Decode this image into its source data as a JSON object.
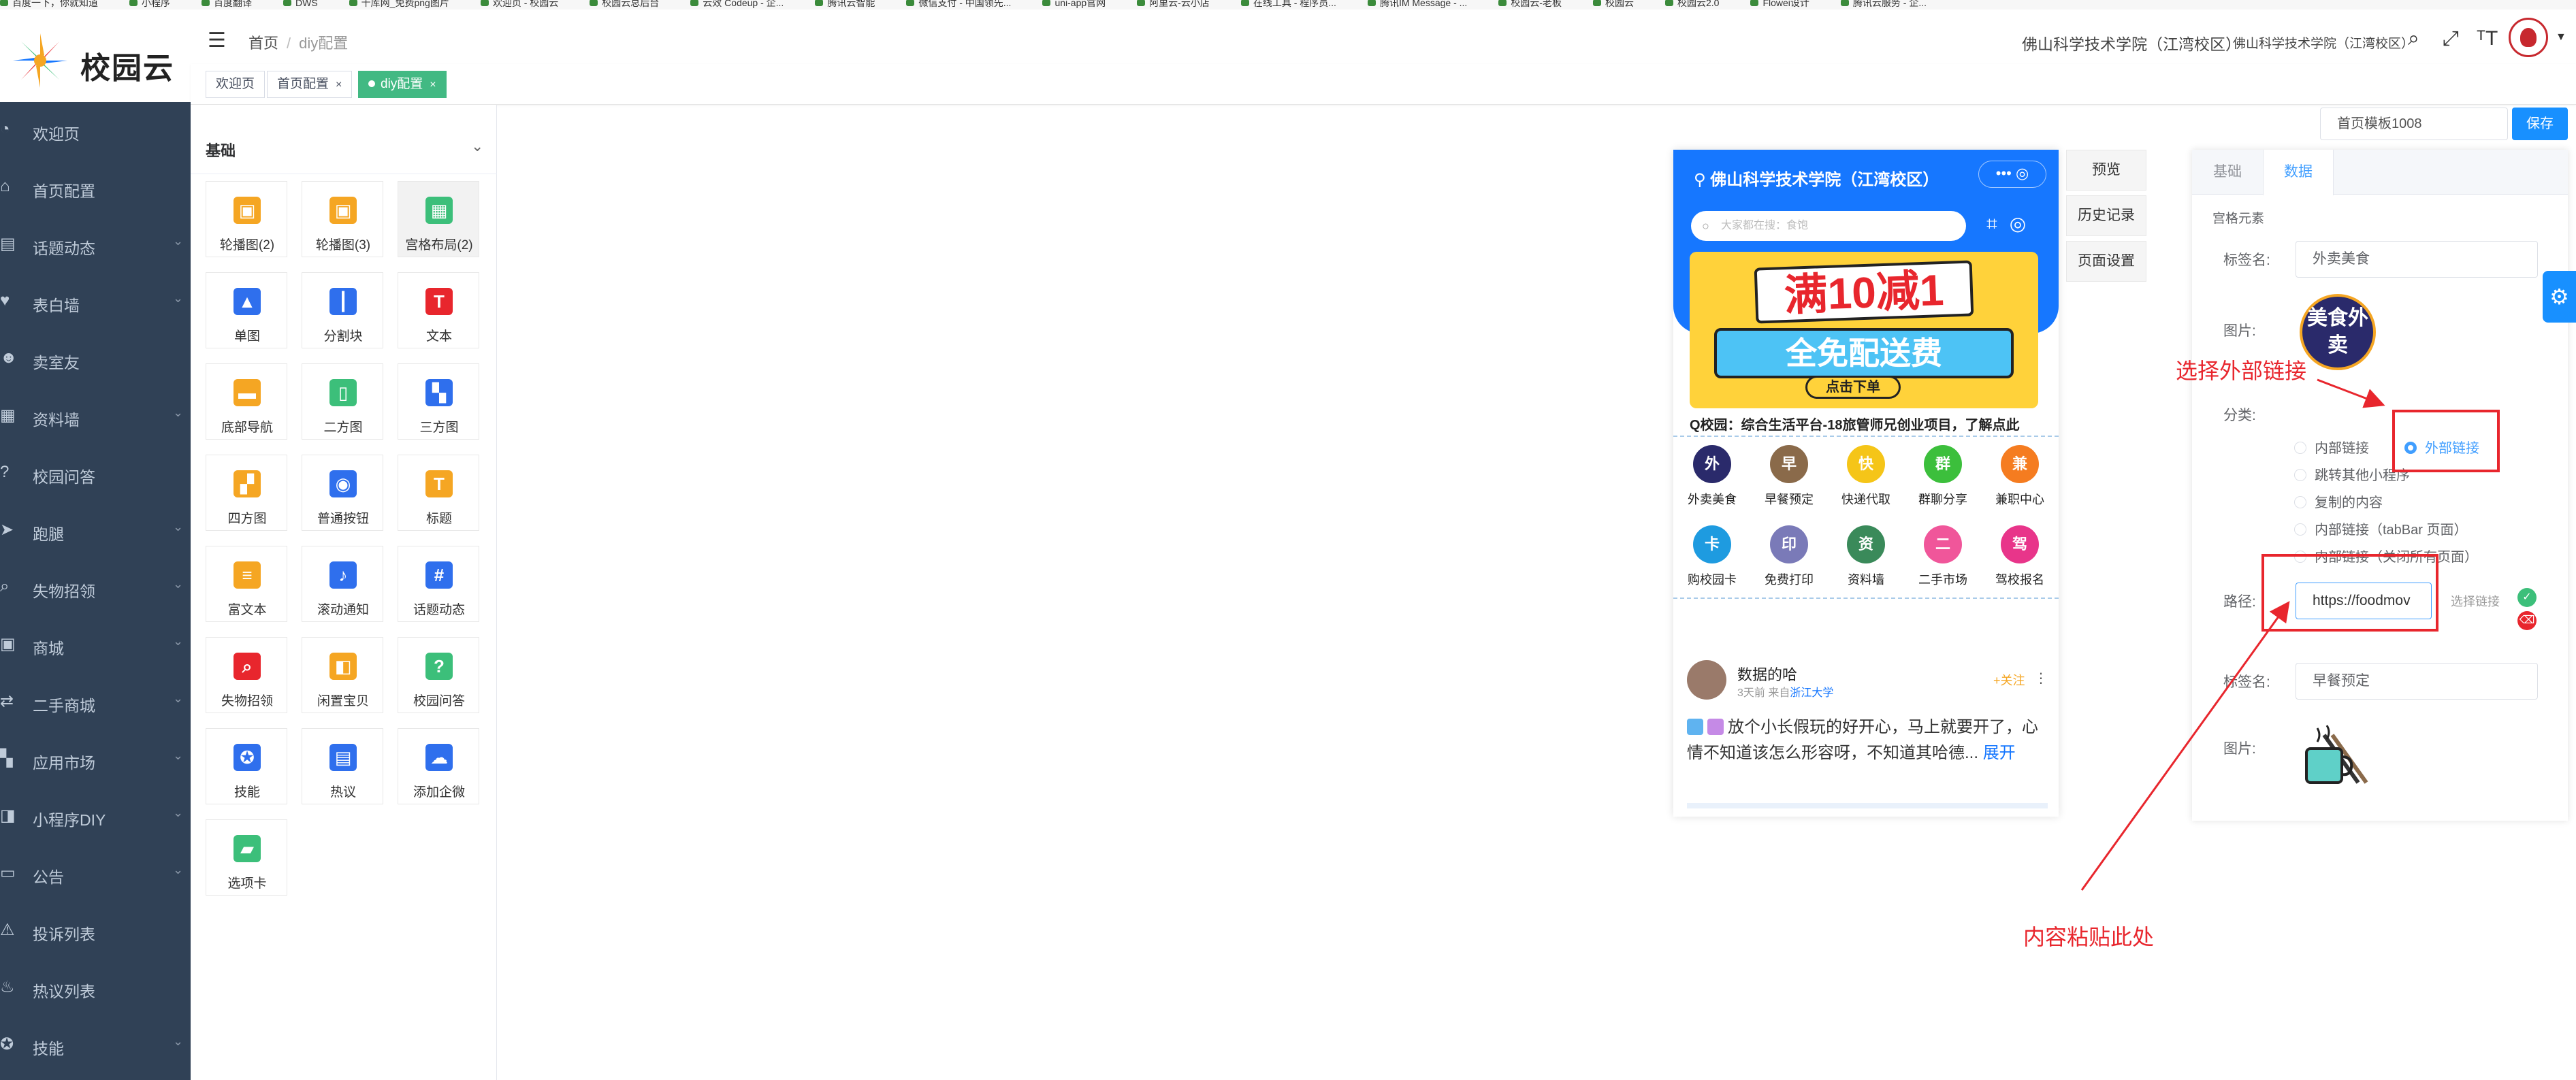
{
  "bookmarks": [
    "百度一下，你就知道",
    "小程序",
    "百度翻译",
    "DWS",
    "千库网_免费png图片",
    "欢迎页 - 校园云",
    "校园云总后台",
    "云效 Codeup - 企...",
    "腾讯云智能",
    "微信支付 - 中国领先...",
    "uni-app官网",
    "阿里云-云小店",
    "在线工具 - 程序员...",
    "腾讯IM Message - ...",
    "校园云-老板",
    "校园云",
    "校园云2.0",
    "Flowei设计",
    "腾讯云服务 - 企..."
  ],
  "logo": {
    "name": "校园云"
  },
  "header": {
    "menu_icon": "menu-fold-icon",
    "crumb_home": "首页",
    "crumb_sep": "/",
    "crumb_current": "diy配置",
    "school": "佛山科学技术学院（江湾校区）",
    "school_small": "佛山科学技术学院（江湾校区）",
    "icons": [
      "search-icon",
      "fullscreen-icon",
      "font-size-icon"
    ]
  },
  "tags": [
    {
      "label": "欢迎页",
      "active": false,
      "closable": false
    },
    {
      "label": "首页配置",
      "active": false,
      "closable": true
    },
    {
      "label": "diy配置",
      "active": true,
      "closable": true
    }
  ],
  "sidebar": {
    "items": [
      {
        "label": "欢迎页",
        "icon": "dashboard-icon",
        "arrow": false
      },
      {
        "label": "首页配置",
        "icon": "home-icon",
        "arrow": false
      },
      {
        "label": "话题动态",
        "icon": "topic-icon",
        "arrow": true
      },
      {
        "label": "表白墙",
        "icon": "heart-icon",
        "arrow": true
      },
      {
        "label": "卖室友",
        "icon": "user-icon",
        "arrow": false
      },
      {
        "label": "资料墙",
        "icon": "grid-icon",
        "arrow": true
      },
      {
        "label": "校园问答",
        "icon": "question-icon",
        "arrow": false
      },
      {
        "label": "跑腿",
        "icon": "run-icon",
        "arrow": true
      },
      {
        "label": "失物招领",
        "icon": "search-box-icon",
        "arrow": true
      },
      {
        "label": "商城",
        "icon": "shop-icon",
        "arrow": true
      },
      {
        "label": "二手商城",
        "icon": "secondhand-icon",
        "arrow": true
      },
      {
        "label": "应用市场",
        "icon": "apps-icon",
        "arrow": true
      },
      {
        "label": "小程序DIY",
        "icon": "diy-icon",
        "arrow": true
      },
      {
        "label": "公告",
        "icon": "notice-icon",
        "arrow": true
      },
      {
        "label": "投诉列表",
        "icon": "warning-icon",
        "arrow": false
      },
      {
        "label": "热议列表",
        "icon": "fire-icon",
        "arrow": false
      },
      {
        "label": "技能",
        "icon": "skill-icon",
        "arrow": true
      }
    ]
  },
  "panel": {
    "title": "基础",
    "components": [
      {
        "label": "轮播图(2)",
        "icon": "carousel-icon",
        "color": "#f5a623",
        "glyph": "▣"
      },
      {
        "label": "轮播图(3)",
        "icon": "carousel-icon",
        "color": "#f5a623",
        "glyph": "▣"
      },
      {
        "label": "宫格布局(2)",
        "icon": "grid-layout-icon",
        "color": "#3cbf7a",
        "glyph": "▦"
      },
      {
        "label": "单图",
        "icon": "image-icon",
        "color": "#2f6fed",
        "glyph": "▲"
      },
      {
        "label": "分割块",
        "icon": "divider-icon",
        "color": "#2f6fed",
        "glyph": "┃"
      },
      {
        "label": "文本",
        "icon": "text-icon",
        "color": "#e8262d",
        "glyph": "T"
      },
      {
        "label": "底部导航",
        "icon": "bottom-nav-icon",
        "color": "#f5a623",
        "glyph": "▬"
      },
      {
        "label": "二方图",
        "icon": "two-image-icon",
        "color": "#3cbf7a",
        "glyph": "▯"
      },
      {
        "label": "三方图",
        "icon": "three-image-icon",
        "color": "#2f6fed",
        "glyph": "▚"
      },
      {
        "label": "四方图",
        "icon": "four-image-icon",
        "color": "#f5a623",
        "glyph": "▞"
      },
      {
        "label": "普通按钮",
        "icon": "button-icon",
        "color": "#2f6fed",
        "glyph": "◉"
      },
      {
        "label": "标题",
        "icon": "title-icon",
        "color": "#f5a623",
        "glyph": "T"
      },
      {
        "label": "富文本",
        "icon": "rich-text-icon",
        "color": "#f5a623",
        "glyph": "≡"
      },
      {
        "label": "滚动通知",
        "icon": "bell-icon",
        "color": "#2f6fed",
        "glyph": "♪"
      },
      {
        "label": "话题动态",
        "icon": "hashtag-icon",
        "color": "#2f6fed",
        "glyph": "#"
      },
      {
        "label": "失物招领",
        "icon": "lost-found-icon",
        "color": "#e8262d",
        "glyph": "⌕"
      },
      {
        "label": "闲置宝贝",
        "icon": "idle-goods-icon",
        "color": "#f5a623",
        "glyph": "◧"
      },
      {
        "label": "校园问答",
        "icon": "qa-icon",
        "color": "#3cbf7a",
        "glyph": "?"
      },
      {
        "label": "技能",
        "icon": "skill-badge-icon",
        "color": "#2f6fed",
        "glyph": "✪"
      },
      {
        "label": "热议",
        "icon": "hot-topic-icon",
        "color": "#2f6fed",
        "glyph": "▤"
      },
      {
        "label": "添加企微",
        "icon": "wecom-icon",
        "color": "#2f6fed",
        "glyph": "☁"
      },
      {
        "label": "选项卡",
        "icon": "tabs-icon",
        "color": "#3cbf7a",
        "glyph": "▰"
      }
    ]
  },
  "phone": {
    "title": "佛山科学技术学院（江湾校区）",
    "pill": "•••  ◎",
    "search_placeholder": "大家都在搜：食饱",
    "banner": {
      "line1": "满10减1",
      "line2": "全免配送费",
      "line3": "点击下单"
    },
    "notice": "Q校园：综合生活平台-18旅管师兄创业项目，了解点此",
    "grid": [
      {
        "label": "外卖美食",
        "color": "#2a2a6b",
        "glyph": "外"
      },
      {
        "label": "早餐预定",
        "color": "#8a6a4a",
        "glyph": "早"
      },
      {
        "label": "快递代取",
        "color": "#f5c518",
        "glyph": "快"
      },
      {
        "label": "群聊分享",
        "color": "#3cbf3c",
        "glyph": "群"
      },
      {
        "label": "兼职中心",
        "color": "#f57c20",
        "glyph": "兼"
      },
      {
        "label": "购校园卡",
        "color": "#1e9be0",
        "glyph": "卡"
      },
      {
        "label": "免费打印",
        "color": "#7a7ab8",
        "glyph": "印"
      },
      {
        "label": "资料墙",
        "color": "#3a8a5a",
        "glyph": "资"
      },
      {
        "label": "二手市场",
        "color": "#f0569a",
        "glyph": "二"
      },
      {
        "label": "驾校报名",
        "color": "#e8358a",
        "glyph": "驾"
      }
    ],
    "post": {
      "name": "数据的哈",
      "meta_time": "3天前 来自",
      "meta_school": "浙江大学",
      "follow": "+关注",
      "text": "放个小长假玩的好开心，马上就要开了，心情不知道该怎么形容呀，不知道其哈德...",
      "more": "展开"
    }
  },
  "side_buttons": [
    "预览",
    "历史记录",
    "页面设置"
  ],
  "template": {
    "value": "首页模板1008",
    "save": "保存"
  },
  "config": {
    "tabs": [
      "基础",
      "数据"
    ],
    "active_tab": "数据",
    "section": "宫格元素",
    "label_name_1": "标签名:",
    "name_value_1": "外卖美食",
    "label_image": "图片:",
    "image_text": "美食外卖",
    "label_category": "分类:",
    "radios": [
      "内部链接",
      "外部链接",
      "跳转其他小程序",
      "复制的内容",
      "内部链接（tabBar 页面）",
      "内部链接（关闭所有页面）"
    ],
    "selected_radio": "外部链接",
    "label_path": "路径:",
    "path_value": "https://foodmov",
    "path_select": "选择链接",
    "label_name_2": "标签名:",
    "name_value_2": "早餐预定",
    "label_image_2": "图片:"
  },
  "annotations": {
    "top": "选择外部链接",
    "bottom": "内容粘贴此处"
  }
}
